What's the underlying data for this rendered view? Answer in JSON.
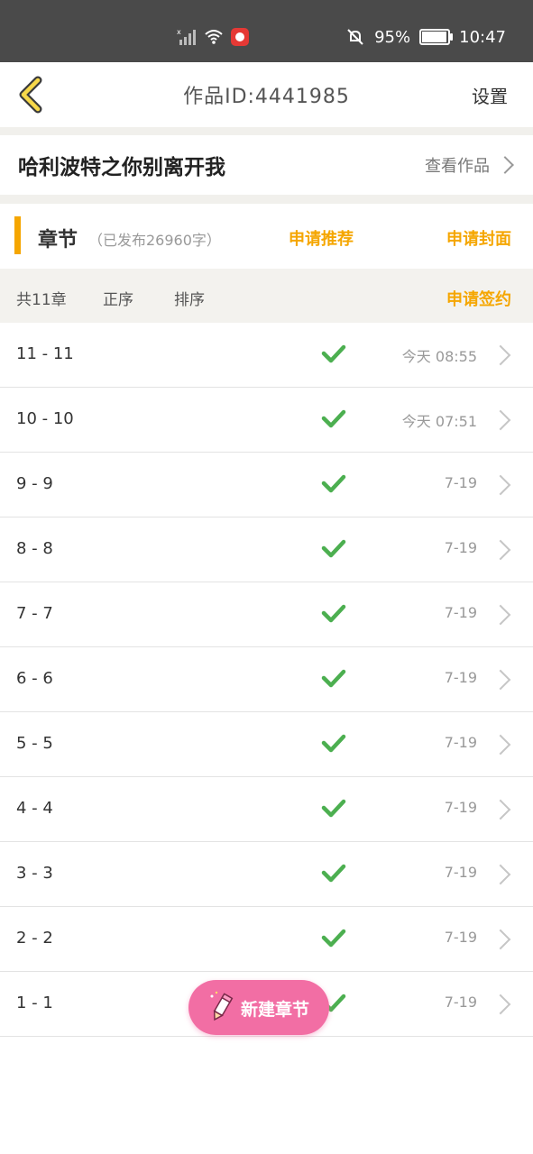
{
  "status_bar": {
    "battery": "95%",
    "battery_level": 0.95,
    "time": "10:47"
  },
  "header": {
    "title": "作品ID:4441985",
    "settings_label": "设置"
  },
  "work": {
    "title": "哈利波特之你别离开我",
    "view_label": "查看作品"
  },
  "chapters": {
    "title": "章节",
    "published_note": "（已发布26960字）",
    "apply_recommend": "申请推荐",
    "apply_cover": "申请封面"
  },
  "sortbar": {
    "total": "共11章",
    "positive_order": "正序",
    "sort": "排序",
    "apply_sign": "申请签约"
  },
  "list": [
    {
      "name": "11 - 11",
      "date": "今天 08:55",
      "status": "published"
    },
    {
      "name": "10 - 10",
      "date": "今天 07:51",
      "status": "published"
    },
    {
      "name": "9 - 9",
      "date": "7-19",
      "status": "published"
    },
    {
      "name": "8 - 8",
      "date": "7-19",
      "status": "published"
    },
    {
      "name": "7 - 7",
      "date": "7-19",
      "status": "published"
    },
    {
      "name": "6 - 6",
      "date": "7-19",
      "status": "published"
    },
    {
      "name": "5 - 5",
      "date": "7-19",
      "status": "published"
    },
    {
      "name": "4 - 4",
      "date": "7-19",
      "status": "published"
    },
    {
      "name": "3 - 3",
      "date": "7-19",
      "status": "published"
    },
    {
      "name": "2 - 2",
      "date": "7-19",
      "status": "published"
    },
    {
      "name": "1 - 1",
      "date": "7-19",
      "status": "published"
    }
  ],
  "fab": {
    "label": "新建章节"
  },
  "colors": {
    "accent_orange": "#f5a600",
    "check_green": "#4caf50",
    "fab_pink": "#f26ea4",
    "statusbar_bg": "#4a4a4a"
  }
}
